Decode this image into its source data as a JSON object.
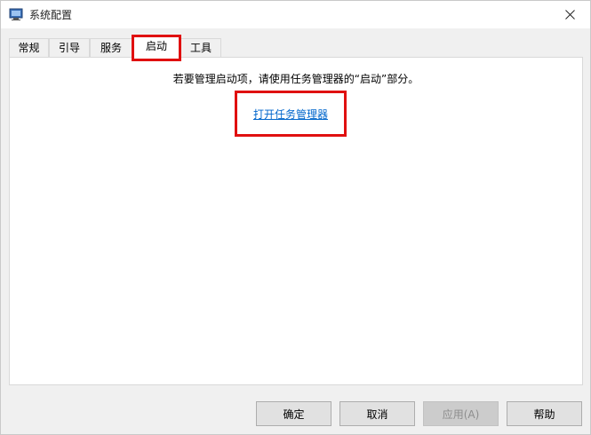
{
  "window": {
    "title": "系统配置"
  },
  "tabs": [
    {
      "label": "常规"
    },
    {
      "label": "引导"
    },
    {
      "label": "服务"
    },
    {
      "label": "启动",
      "active": true
    },
    {
      "label": "工具"
    }
  ],
  "startup_panel": {
    "instructions": "若要管理启动项，请使用任务管理器的“启动”部分。",
    "link_label": "打开任务管理器"
  },
  "buttons": {
    "ok": "确定",
    "cancel": "取消",
    "apply": "应用(A)",
    "help": "帮助"
  },
  "icons": {
    "title": "system-config-icon",
    "close": "close-icon"
  },
  "colors": {
    "highlight_border": "#e01010",
    "link": "#0066cc"
  }
}
